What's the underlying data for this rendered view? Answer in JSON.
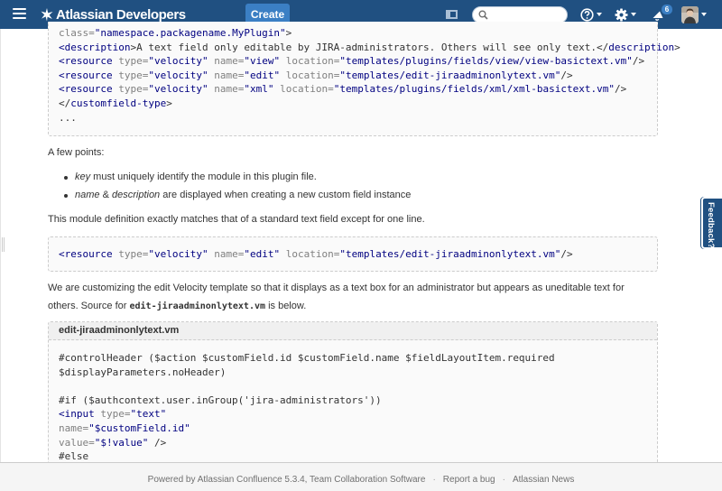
{
  "header": {
    "brand": "Atlassian Developers",
    "create_label": "Create",
    "search_placeholder": "",
    "notification_count": "6",
    "icons": [
      "menu-icon",
      "atlassian-logo-icon",
      "sidebar-toggle-icon",
      "search-icon",
      "help-icon",
      "gear-icon",
      "notification-icon",
      "avatar"
    ]
  },
  "code_top": {
    "lines": [
      [
        {
          "c": "at",
          "t": "class="
        },
        {
          "c": "va",
          "t": "\"namespace.packagename.MyPlugin\""
        },
        {
          "c": "",
          "t": ">"
        }
      ],
      [
        {
          "c": "tg",
          "t": "<description"
        },
        {
          "c": "",
          "t": ">A text field only editable by JIRA-administrators. Others will see only text.</"
        },
        {
          "c": "tg",
          "t": "description"
        },
        {
          "c": "",
          "t": ">"
        }
      ],
      [
        {
          "c": "tg",
          "t": "<resource"
        },
        {
          "c": "",
          "t": " "
        },
        {
          "c": "at",
          "t": "type="
        },
        {
          "c": "va",
          "t": "\"velocity\""
        },
        {
          "c": "",
          "t": " "
        },
        {
          "c": "at",
          "t": "name="
        },
        {
          "c": "va",
          "t": "\"view\""
        },
        {
          "c": "",
          "t": " "
        },
        {
          "c": "at",
          "t": "location="
        },
        {
          "c": "va",
          "t": "\"templates/plugins/fields/view/view-basictext.vm\""
        },
        {
          "c": "",
          "t": "/>"
        }
      ],
      [
        {
          "c": "tg",
          "t": "<resource"
        },
        {
          "c": "",
          "t": " "
        },
        {
          "c": "at",
          "t": "type="
        },
        {
          "c": "va",
          "t": "\"velocity\""
        },
        {
          "c": "",
          "t": " "
        },
        {
          "c": "at",
          "t": "name="
        },
        {
          "c": "va",
          "t": "\"edit\""
        },
        {
          "c": "",
          "t": " "
        },
        {
          "c": "at",
          "t": "location="
        },
        {
          "c": "va",
          "t": "\"templates/edit-jiraadminonlytext.vm\""
        },
        {
          "c": "",
          "t": "/>"
        }
      ],
      [
        {
          "c": "tg",
          "t": "<resource"
        },
        {
          "c": "",
          "t": " "
        },
        {
          "c": "at",
          "t": "type="
        },
        {
          "c": "va",
          "t": "\"velocity\""
        },
        {
          "c": "",
          "t": " "
        },
        {
          "c": "at",
          "t": "name="
        },
        {
          "c": "va",
          "t": "\"xml\""
        },
        {
          "c": "",
          "t": " "
        },
        {
          "c": "at",
          "t": "location="
        },
        {
          "c": "va",
          "t": "\"templates/plugins/fields/xml/xml-basictext.vm\""
        },
        {
          "c": "",
          "t": "/>"
        }
      ],
      [
        {
          "c": "",
          "t": "</"
        },
        {
          "c": "tg",
          "t": "customfield-type"
        },
        {
          "c": "",
          "t": ">"
        }
      ],
      [
        {
          "c": "",
          "t": "..."
        }
      ]
    ]
  },
  "content": {
    "few_points": "A few points:",
    "bullet1_em": "key",
    "bullet1_rest": " must uniquely identify the module in this plugin file.",
    "bullet2_em1": "name",
    "bullet2_mid": " & ",
    "bullet2_em2": "description",
    "bullet2_rest": " are displayed when creating a new custom field instance",
    "module_def": "This module definition exactly matches that of a standard text field except for one line.",
    "custom_line1": "We are customizing the edit Velocity template so that it displays as a text box for an administrator but appears as uneditable text for",
    "custom_line2_pre": "others. Source for ",
    "custom_code": "edit-jiraadminonlytext.vm",
    "custom_line2_post": " is below."
  },
  "code_mid": {
    "lines": [
      [
        {
          "c": "tg",
          "t": "<resource"
        },
        {
          "c": "",
          "t": " "
        },
        {
          "c": "at",
          "t": "type="
        },
        {
          "c": "va",
          "t": "\"velocity\""
        },
        {
          "c": "",
          "t": " "
        },
        {
          "c": "at",
          "t": "name="
        },
        {
          "c": "va",
          "t": "\"edit\""
        },
        {
          "c": "",
          "t": " "
        },
        {
          "c": "at",
          "t": "location="
        },
        {
          "c": "va",
          "t": "\"templates/edit-jiraadminonlytext.vm\""
        },
        {
          "c": "",
          "t": "/>"
        }
      ]
    ]
  },
  "code_bottom": {
    "title": "edit-jiraadminonlytext.vm",
    "lines": [
      [
        {
          "c": "",
          "t": "#controlHeader ($action $customField.id $customField.name $fieldLayoutItem.required"
        }
      ],
      [
        {
          "c": "",
          "t": "$displayParameters.noHeader)"
        }
      ],
      [
        {
          "c": "",
          "t": ""
        }
      ],
      [
        {
          "c": "",
          "t": "#if ($authcontext.user.inGroup('jira-administrators'))"
        }
      ],
      [
        {
          "c": "tg",
          "t": "<input"
        },
        {
          "c": "",
          "t": " "
        },
        {
          "c": "at",
          "t": "type="
        },
        {
          "c": "va",
          "t": "\"text\""
        }
      ],
      [
        {
          "c": "at",
          "t": "name="
        },
        {
          "c": "va",
          "t": "\"$customField.id\""
        }
      ],
      [
        {
          "c": "at",
          "t": "value="
        },
        {
          "c": "va",
          "t": "\"$!value\""
        },
        {
          "c": "",
          "t": " />"
        }
      ],
      [
        {
          "c": "",
          "t": "#else"
        }
      ]
    ]
  },
  "feedback": {
    "label": "Feedback?"
  },
  "footer": {
    "powered": "Powered by Atlassian Confluence 5.3.4, Team Collaboration Software",
    "sep": "·",
    "report": "Report a bug",
    "news": "Atlassian News"
  },
  "colors": {
    "header_bg": "#205081",
    "create_bg": "#3b7fc4",
    "code_tag": "#000080",
    "code_attr": "#7f7f7f",
    "code_value": "#000080"
  }
}
